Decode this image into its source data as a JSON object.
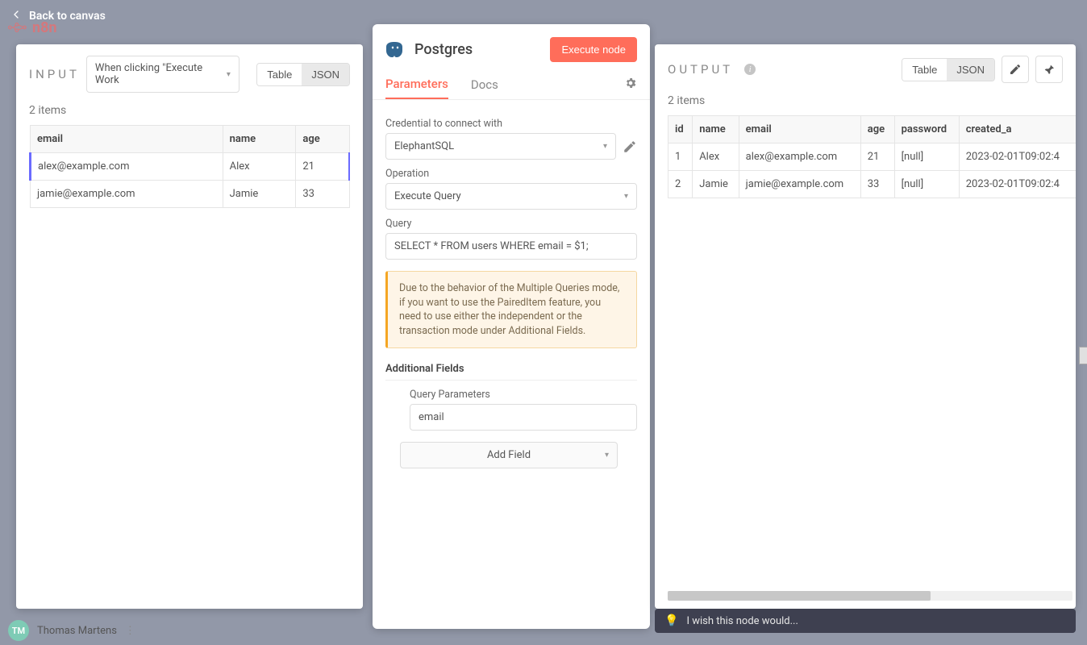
{
  "topbar": {
    "back_label": "Back to canvas",
    "brand": "n8n"
  },
  "input_panel": {
    "title": "INPUT",
    "source_label": "When clicking \"Execute Work",
    "seg_table": "Table",
    "seg_json": "JSON",
    "items_label": "2 items",
    "columns": [
      "email",
      "name",
      "age"
    ],
    "rows": [
      {
        "email": "alex@example.com",
        "name": "Alex",
        "age": "21"
      },
      {
        "email": "jamie@example.com",
        "name": "Jamie",
        "age": "33"
      }
    ]
  },
  "center_panel": {
    "title": "Postgres",
    "execute_label": "Execute node",
    "tab_parameters": "Parameters",
    "tab_docs": "Docs",
    "label_credential": "Credential to connect with",
    "credential_value": "ElephantSQL",
    "label_operation": "Operation",
    "operation_value": "Execute Query",
    "label_query": "Query",
    "query_value": "SELECT * FROM users WHERE email = $1;",
    "banner_text": "Due to the behavior of the Multiple Queries mode, if you want to use the PairedItem feature, you need to use either the independent or the transaction mode under Additional Fields.",
    "additional_fields_title": "Additional Fields",
    "label_query_params": "Query Parameters",
    "query_params_value": "email",
    "add_field_label": "Add Field"
  },
  "output_panel": {
    "title": "OUTPUT",
    "seg_table": "Table",
    "seg_json": "JSON",
    "items_label": "2 items",
    "columns": [
      "id",
      "name",
      "email",
      "age",
      "password",
      "created_a"
    ],
    "rows": [
      {
        "id": "1",
        "name": "Alex",
        "email": "alex@example.com",
        "age": "21",
        "password": "[null]",
        "created_at": "2023-02-01T09:02:4"
      },
      {
        "id": "2",
        "name": "Jamie",
        "email": "jamie@example.com",
        "age": "33",
        "password": "[null]",
        "created_at": "2023-02-01T09:02:4"
      }
    ]
  },
  "bottombar": {
    "user_initials": "TM",
    "user_name": "Thomas Martens",
    "wish_text": "I wish this node would..."
  }
}
